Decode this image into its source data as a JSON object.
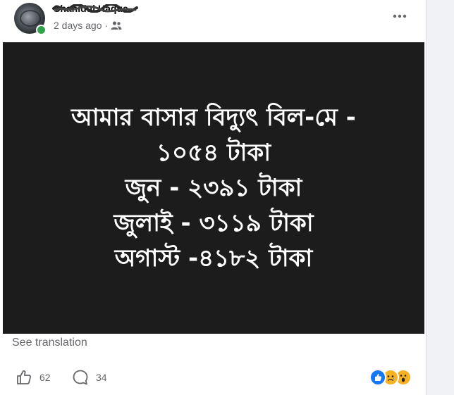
{
  "post": {
    "author_name": "Shahidul Haque",
    "timestamp": "2 days ago",
    "separator": "·",
    "audience_icon": "friends-icon",
    "more_icon": "more-options-icon"
  },
  "image_text": {
    "line1": "আমার বাসার বিদ্যুৎ বিল-মে -",
    "line2": "১০৫৪ টাকা",
    "line3": "জুন - ২৩৯১ টাকা",
    "line4": "জুলাই - ৩১১৯ টাকা",
    "line5": "অগাস্ট -৪১৮২ টাকা"
  },
  "see_translation": "See translation",
  "footer": {
    "like_count": "62",
    "comment_count": "34",
    "reactions": [
      "like",
      "sad",
      "wow"
    ]
  },
  "colors": {
    "image_background": "#1c1c1c",
    "like_blue": "#1877f2",
    "online_green": "#31a24c",
    "secondary_text": "#65676b"
  }
}
